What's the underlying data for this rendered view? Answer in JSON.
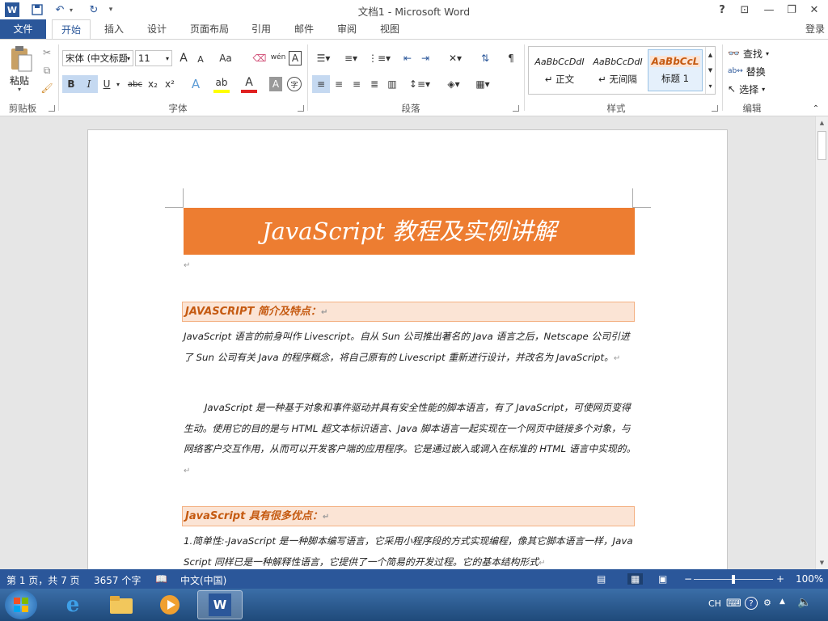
{
  "app": {
    "title": "文档1 - Microsoft Word"
  },
  "titlebar": {
    "help": "?",
    "restore_ribbon": "⊡",
    "minimize": "—",
    "maximize": "❐",
    "close": "✕"
  },
  "tabs": [
    {
      "label": "文件"
    },
    {
      "label": "开始"
    },
    {
      "label": "插入"
    },
    {
      "label": "设计"
    },
    {
      "label": "页面布局"
    },
    {
      "label": "引用"
    },
    {
      "label": "邮件"
    },
    {
      "label": "审阅"
    },
    {
      "label": "视图"
    }
  ],
  "login": "登录",
  "ribbon": {
    "clipboard": {
      "label": "剪贴板",
      "paste": "粘贴"
    },
    "font": {
      "label": "字体",
      "name": "宋体 (中文标题",
      "size": "11",
      "phonetic": "wén",
      "change_case": "Aa",
      "bold": "B",
      "italic": "I",
      "underline": "U",
      "strike": "abc",
      "sub": "x₂",
      "sup": "x²",
      "grow": "A",
      "shrink": "A",
      "text_effect": "A",
      "font_color": "A",
      "shading": "A",
      "enclose": "字"
    },
    "paragraph": {
      "label": "段落"
    },
    "styles": {
      "label": "样式",
      "items": [
        {
          "sample": "AaBbCcDdI",
          "name": "↵ 正文"
        },
        {
          "sample": "AaBbCcDdI",
          "name": "↵ 无间隔"
        },
        {
          "sample": "AaBbCcL",
          "name": "标题 1"
        }
      ]
    },
    "editing": {
      "label": "编辑",
      "find": "查找",
      "replace": "替换",
      "select": "选择"
    }
  },
  "document": {
    "title": "JavaScript 教程及实例讲解",
    "heading1": "JAVASCRIPT 简介及特点：",
    "para1": "JavaScript 语言的前身叫作 Livescript。自从 Sun 公司推出著名的 Java 语言之后，Netscape 公司引进了 Sun 公司有关 Java 的程序概念，将自己原有的 Livescript 重新进行设计，并改名为 JavaScript。",
    "para2": "JavaScript 是一种基于对象和事件驱动并具有安全性能的脚本语言，有了 JavaScript，可使网页变得生动。使用它的目的是与 HTML 超文本标识语言、Java 脚本语言一起实现在一个网页中链接多个对象，与网络客户交互作用，从而可以开发客户端的应用程序。它是通过嵌入或调入在标准的 HTML 语言中实现的。",
    "heading2": "JavaScript 具有很多优点：",
    "para3": "1.简单性:-JavaScript 是一种脚本编写语言，它采用小程序段的方式实现编程，像其它脚本语言一样，JavaScript 同样已是一种解释性语言，它提供了一个简易的开发过程。它的基本结构形式",
    "para_mark": "↵"
  },
  "status": {
    "page": "第 1 页，共 7 页",
    "words": "3657 个字",
    "language": "中文(中国)",
    "zoom": "100%",
    "zoom_level": 0.5
  },
  "tray": {
    "ime": "CH"
  },
  "colors": {
    "accent": "#2b579a",
    "banner": "#ed7d31",
    "heading_bg": "#fbe4d5"
  }
}
